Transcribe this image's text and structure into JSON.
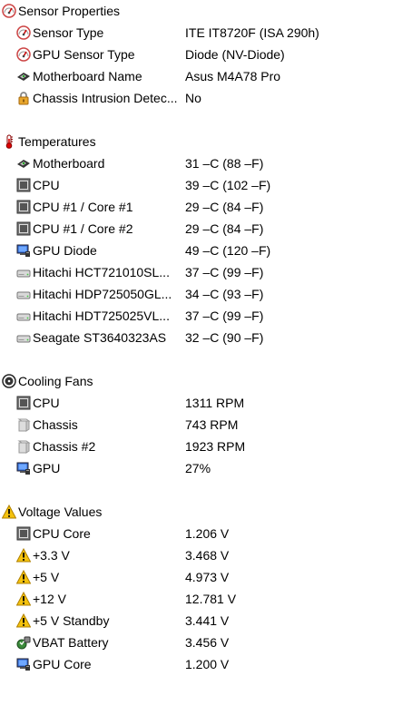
{
  "sections": [
    {
      "title": "Sensor Properties",
      "icon": "sensor-gauge-icon",
      "items": [
        {
          "label": "Sensor Type",
          "value": "ITE IT8720F  (ISA 290h)",
          "icon": "sensor-gauge-icon"
        },
        {
          "label": "GPU Sensor Type",
          "value": "Diode  (NV-Diode)",
          "icon": "sensor-gauge-icon"
        },
        {
          "label": "Motherboard Name",
          "value": "Asus M4A78 Pro",
          "icon": "motherboard-icon"
        },
        {
          "label": "Chassis Intrusion Detec...",
          "value": "No",
          "icon": "padlock-icon"
        }
      ]
    },
    {
      "title": "Temperatures",
      "icon": "thermometer-icon",
      "items": [
        {
          "label": "Motherboard",
          "value": "31 –C  (88 –F)",
          "icon": "motherboard-icon"
        },
        {
          "label": "CPU",
          "value": "39 –C  (102 –F)",
          "icon": "cpu-chip-icon"
        },
        {
          "label": "CPU #1 / Core #1",
          "value": "29 –C  (84 –F)",
          "icon": "cpu-chip-icon"
        },
        {
          "label": "CPU #1 / Core #2",
          "value": "29 –C  (84 –F)",
          "icon": "cpu-chip-icon"
        },
        {
          "label": "GPU Diode",
          "value": "49 –C  (120 –F)",
          "icon": "gpu-monitor-icon"
        },
        {
          "label": "Hitachi HCT721010SL...",
          "value": "37 –C  (99 –F)",
          "icon": "hard-drive-icon"
        },
        {
          "label": "Hitachi HDP725050GL...",
          "value": "34 –C  (93 –F)",
          "icon": "hard-drive-icon"
        },
        {
          "label": "Hitachi HDT725025VL...",
          "value": "37 –C  (99 –F)",
          "icon": "hard-drive-icon"
        },
        {
          "label": "Seagate ST3640323AS",
          "value": "32 –C  (90 –F)",
          "icon": "hard-drive-icon"
        }
      ]
    },
    {
      "title": "Cooling Fans",
      "icon": "fan-icon",
      "items": [
        {
          "label": "CPU",
          "value": "1311 RPM",
          "icon": "cpu-chip-icon"
        },
        {
          "label": "Chassis",
          "value": "743 RPM",
          "icon": "chassis-case-icon"
        },
        {
          "label": "Chassis #2",
          "value": "1923 RPM",
          "icon": "chassis-case-icon"
        },
        {
          "label": "GPU",
          "value": "27%",
          "icon": "gpu-monitor-icon"
        }
      ]
    },
    {
      "title": "Voltage Values",
      "icon": "warning-triangle-icon",
      "items": [
        {
          "label": "CPU Core",
          "value": "1.206 V",
          "icon": "cpu-chip-icon"
        },
        {
          "label": "+3.3 V",
          "value": "3.468 V",
          "icon": "warning-triangle-icon"
        },
        {
          "label": "+5 V",
          "value": "4.973 V",
          "icon": "warning-triangle-icon"
        },
        {
          "label": "+12 V",
          "value": "12.781 V",
          "icon": "warning-triangle-icon"
        },
        {
          "label": "+5 V Standby",
          "value": "3.441 V",
          "icon": "warning-triangle-icon"
        },
        {
          "label": "VBAT Battery",
          "value": "3.456 V",
          "icon": "battery-icon"
        },
        {
          "label": "GPU Core",
          "value": "1.200 V",
          "icon": "gpu-monitor-icon"
        }
      ]
    }
  ]
}
